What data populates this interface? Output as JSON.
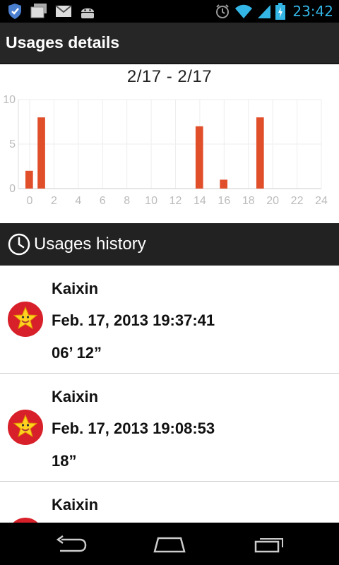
{
  "status_bar": {
    "time": "23:42",
    "left_icons": [
      "shield-icon",
      "gallery-icon",
      "gmail-icon",
      "android-icon"
    ],
    "right_icons": [
      "alarm-icon",
      "wifi-icon",
      "signal-icon",
      "battery-charging-icon"
    ]
  },
  "action_bar": {
    "title": "Usages details"
  },
  "chart": {
    "date_range": "2/17 - 2/17"
  },
  "chart_data": {
    "type": "bar",
    "title": "",
    "xlabel": "",
    "ylabel": "",
    "x": [
      0,
      1,
      14,
      16,
      19
    ],
    "values": [
      2,
      8,
      7,
      1,
      8
    ],
    "xlim": [
      0,
      24
    ],
    "ylim": [
      0,
      10
    ],
    "x_ticks": [
      "0",
      "2",
      "4",
      "6",
      "8",
      "10",
      "12",
      "14",
      "16",
      "18",
      "20",
      "22",
      "24"
    ],
    "y_ticks": [
      "0",
      "5",
      "10"
    ],
    "grid": true,
    "color": "#e04e2a"
  },
  "history": {
    "header": "Usages history",
    "items": [
      {
        "name": "Kaixin",
        "date": "Feb. 17, 2013 19:37:41",
        "duration": "06’ 12”"
      },
      {
        "name": "Kaixin",
        "date": "Feb. 17, 2013 19:08:53",
        "duration": "18”"
      },
      {
        "name": "Kaixin",
        "date": "",
        "duration": ""
      }
    ]
  },
  "nav_bar": {
    "buttons": [
      "back-icon",
      "home-icon",
      "recent-apps-icon"
    ]
  },
  "colors": {
    "accent": "#33b5e5",
    "bar": "#e04e2a",
    "header_bg": "#262626"
  }
}
